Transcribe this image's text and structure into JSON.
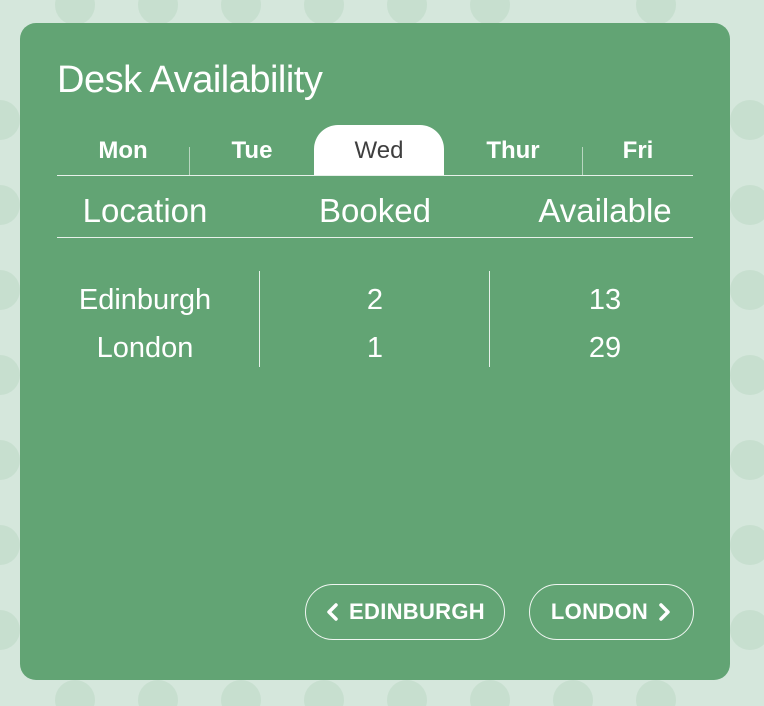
{
  "widget": {
    "title": "Desk Availability",
    "tabs": [
      {
        "label": "Mon",
        "active": false
      },
      {
        "label": "Tue",
        "active": false
      },
      {
        "label": "Wed",
        "active": true
      },
      {
        "label": "Thur",
        "active": false
      },
      {
        "label": "Fri",
        "active": false
      }
    ],
    "columns": [
      "Location",
      "Booked",
      "Available"
    ],
    "rows": [
      {
        "location": "Edinburgh",
        "booked": "2",
        "available": "13"
      },
      {
        "location": "London",
        "booked": "1",
        "available": "29"
      }
    ],
    "prev_button": {
      "label": "EDINBURGH",
      "icon": "chevron-left-icon"
    },
    "next_button": {
      "label": "LONDON",
      "icon": "chevron-right-icon"
    }
  },
  "colors": {
    "background": "#d5e7dc",
    "card": "#62a474",
    "text": "#ffffff",
    "active_tab_bg": "#ffffff",
    "active_tab_text": "#3f3f3f"
  }
}
